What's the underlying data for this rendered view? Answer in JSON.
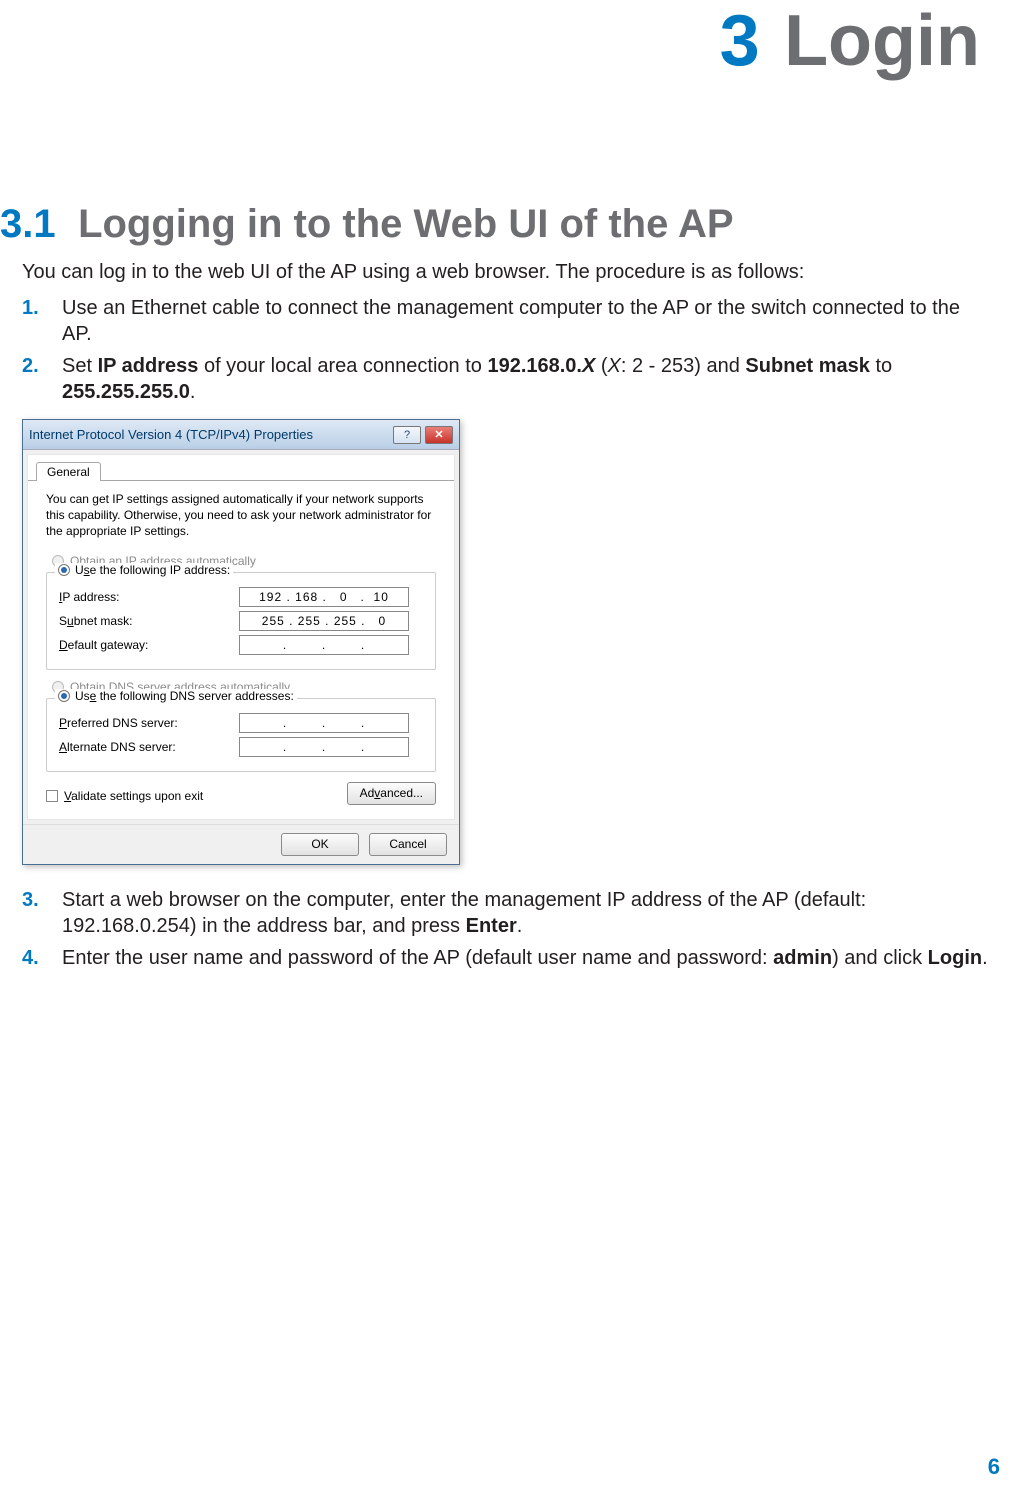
{
  "chapter": {
    "number": "3",
    "title": "Login"
  },
  "section": {
    "number": "3.1",
    "title": "Logging in to the Web UI of the AP"
  },
  "intro": "You can log in to the web UI of the AP using a web browser. The procedure is as follows:",
  "steps": {
    "s1": {
      "num": "1.",
      "text": "Use an Ethernet cable to connect the management computer to the AP or the switch connected to the AP."
    },
    "s2": {
      "num": "2.",
      "pre": "Set ",
      "ip_label": "IP address",
      "mid1": " of your local area connection to ",
      "ip_value": "192.168.0.",
      "ip_var": "X",
      "range": " (",
      "range_var": "X",
      "range_txt": ": 2 - 253) and ",
      "mask_label": "Subnet mask",
      "mid2": " to ",
      "mask_value": "255.255.255.0",
      "end": "."
    },
    "s3": {
      "num": "3.",
      "pre": "Start a web browser on the computer, enter the management IP address of the AP (default: 192.168.0.254) in the address bar, and press ",
      "key": "Enter",
      "end": "."
    },
    "s4": {
      "num": "4.",
      "pre": "Enter the user name and password of the AP (default user name and password: ",
      "cred": "admin",
      "mid": ") and click ",
      "btn": "Login",
      "end": "."
    }
  },
  "dialog": {
    "title": "Internet Protocol Version 4 (TCP/IPv4) Properties",
    "tab": "General",
    "desc": "You can get IP settings assigned automatically if your network supports this capability. Otherwise, you need to ask your network administrator for the appropriate IP settings.",
    "radio_auto_ip": "Obtain an IP address automatically",
    "radio_manual_ip": "Use the following IP address:",
    "fields": {
      "ip": {
        "label": "IP address:",
        "value": "192 . 168 .   0   .  10"
      },
      "mask": {
        "label": "Subnet mask:",
        "value": "255 . 255 . 255 .   0"
      },
      "gw": {
        "label": "Default gateway:",
        "value": ".        .        ."
      }
    },
    "radio_auto_dns": "Obtain DNS server address automatically",
    "radio_manual_dns": "Use the following DNS server addresses:",
    "dns": {
      "pref": {
        "label": "Preferred DNS server:",
        "value": ".        .        ."
      },
      "alt": {
        "label": "Alternate DNS server:",
        "value": ".        .        ."
      }
    },
    "validate": "Validate settings upon exit",
    "advanced": "Advanced...",
    "ok": "OK",
    "cancel": "Cancel",
    "help_icon": "?",
    "close_icon": "✕"
  },
  "page_number": "6",
  "underlines": {
    "O": "O",
    "s": "s",
    "I": "I",
    "u": "u",
    "D": "D",
    "b": "b",
    "e": "e",
    "P": "P",
    "A": "A",
    "V": "V",
    "v": "v"
  }
}
